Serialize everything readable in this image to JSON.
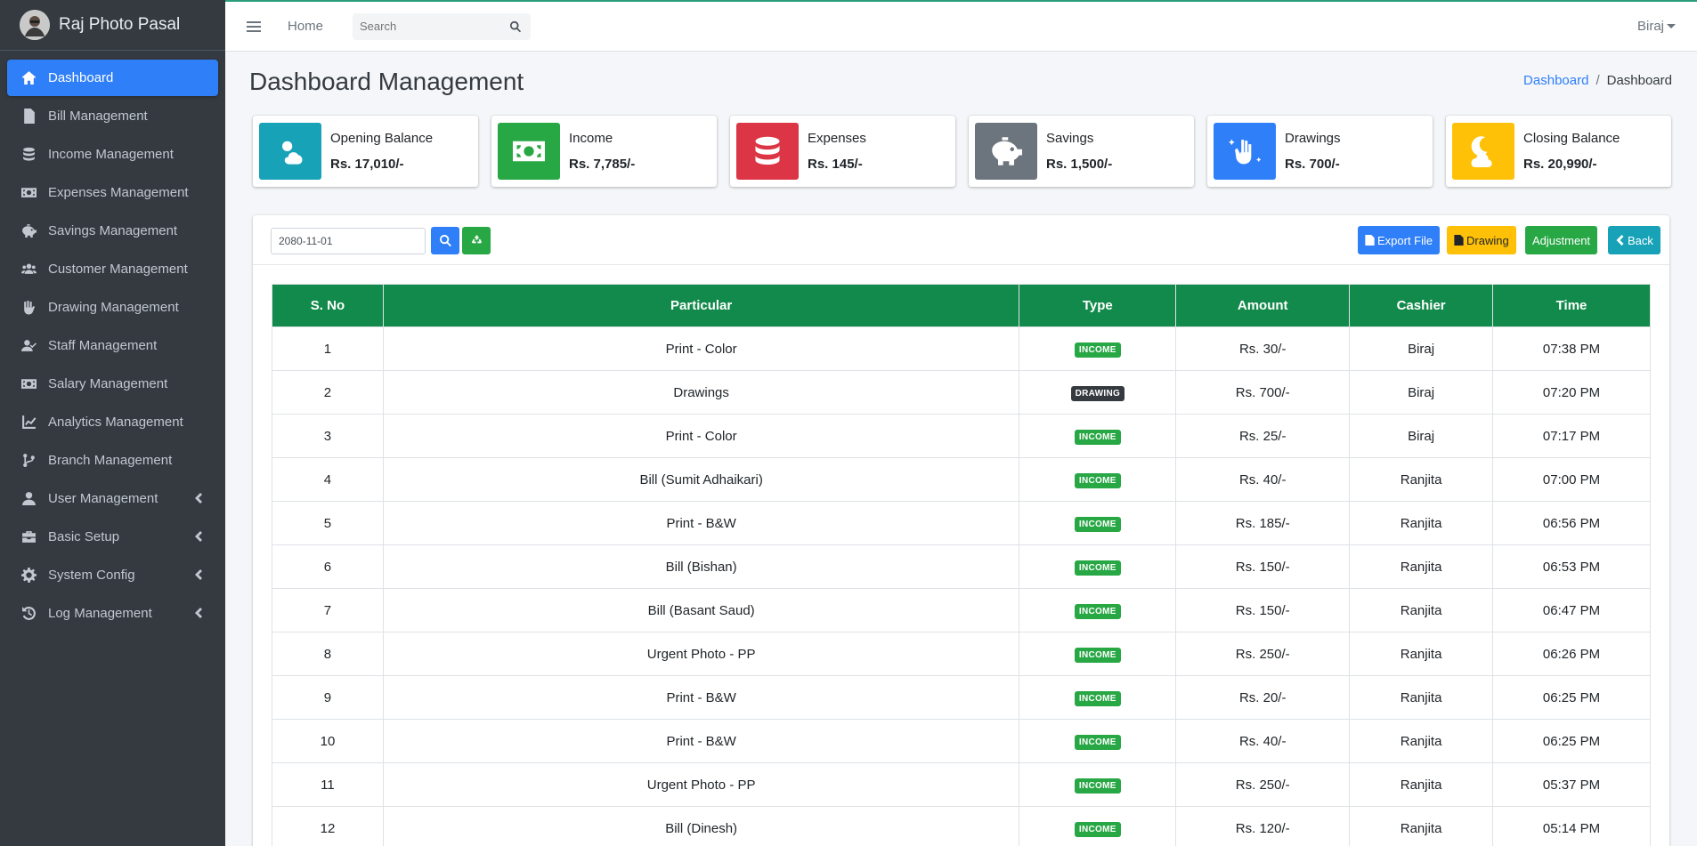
{
  "brand": {
    "name": "Raj Photo Pasal"
  },
  "sidebar": {
    "items": [
      {
        "label": "Dashboard",
        "icon": "home-icon",
        "active": true,
        "submenu": false
      },
      {
        "label": "Bill Management",
        "icon": "file-icon",
        "active": false,
        "submenu": false
      },
      {
        "label": "Income Management",
        "icon": "coins-icon",
        "active": false,
        "submenu": false
      },
      {
        "label": "Expenses Management",
        "icon": "money-bill-icon",
        "active": false,
        "submenu": false
      },
      {
        "label": "Savings Management",
        "icon": "piggy-bank-icon",
        "active": false,
        "submenu": false
      },
      {
        "label": "Customer Management",
        "icon": "users-icon",
        "active": false,
        "submenu": false
      },
      {
        "label": "Drawing Management",
        "icon": "hand-holding-icon",
        "active": false,
        "submenu": false
      },
      {
        "label": "Staff Management",
        "icon": "user-check-icon",
        "active": false,
        "submenu": false
      },
      {
        "label": "Salary Management",
        "icon": "money-bill-icon",
        "active": false,
        "submenu": false
      },
      {
        "label": "Analytics Management",
        "icon": "chart-line-icon",
        "active": false,
        "submenu": false
      },
      {
        "label": "Branch Management",
        "icon": "code-branch-icon",
        "active": false,
        "submenu": false
      },
      {
        "label": "User Management",
        "icon": "user-icon",
        "active": false,
        "submenu": true
      },
      {
        "label": "Basic Setup",
        "icon": "toolbox-icon",
        "active": false,
        "submenu": true
      },
      {
        "label": "System Config",
        "icon": "gear-icon",
        "active": false,
        "submenu": true
      },
      {
        "label": "Log Management",
        "icon": "history-icon",
        "active": false,
        "submenu": true
      }
    ]
  },
  "topbar": {
    "home_label": "Home",
    "search_placeholder": "Search",
    "user_name": "Biraj"
  },
  "page": {
    "title": "Dashboard Management",
    "breadcrumb_link": "Dashboard",
    "breadcrumb_current": "Dashboard"
  },
  "cards": [
    {
      "label": "Opening Balance",
      "value": "Rs. 17,010/-",
      "color": "#17a2b8",
      "icon": "cloud-sun-icon"
    },
    {
      "label": "Income",
      "value": "Rs. 7,785/-",
      "color": "#28a745",
      "icon": "money-bill-icon"
    },
    {
      "label": "Expenses",
      "value": "Rs. 145/-",
      "color": "#dc3545",
      "icon": "coins-icon"
    },
    {
      "label": "Savings",
      "value": "Rs. 1,500/-",
      "color": "#6c757d",
      "icon": "piggy-bank-icon"
    },
    {
      "label": "Drawings",
      "value": "Rs. 700/-",
      "color": "#2f7ff8",
      "icon": "hand-sparkles-icon"
    },
    {
      "label": "Closing Balance",
      "value": "Rs. 20,990/-",
      "color": "#ffc107",
      "icon": "cloud-moon-icon"
    }
  ],
  "filter": {
    "date_value": "2080-11-01"
  },
  "actions": {
    "export_label": "Export File",
    "drawing_label": "Drawing",
    "adjustment_label": "Adjustment",
    "back_label": "Back"
  },
  "table": {
    "headers": [
      "S. No",
      "Particular",
      "Type",
      "Amount",
      "Cashier",
      "Time"
    ],
    "rows": [
      {
        "sno": "1",
        "particular": "Print - Color",
        "type": "INCOME",
        "amount": "Rs. 30/-",
        "cashier": "Biraj",
        "time": "07:38 PM"
      },
      {
        "sno": "2",
        "particular": "Drawings",
        "type": "DRAWING",
        "amount": "Rs. 700/-",
        "cashier": "Biraj",
        "time": "07:20 PM"
      },
      {
        "sno": "3",
        "particular": "Print - Color",
        "type": "INCOME",
        "amount": "Rs. 25/-",
        "cashier": "Biraj",
        "time": "07:17 PM"
      },
      {
        "sno": "4",
        "particular": "Bill (Sumit Adhaikari)",
        "type": "INCOME",
        "amount": "Rs. 40/-",
        "cashier": "Ranjita",
        "time": "07:00 PM"
      },
      {
        "sno": "5",
        "particular": "Print - B&W",
        "type": "INCOME",
        "amount": "Rs. 185/-",
        "cashier": "Ranjita",
        "time": "06:56 PM"
      },
      {
        "sno": "6",
        "particular": "Bill (Bishan)",
        "type": "INCOME",
        "amount": "Rs. 150/-",
        "cashier": "Ranjita",
        "time": "06:53 PM"
      },
      {
        "sno": "7",
        "particular": "Bill (Basant Saud)",
        "type": "INCOME",
        "amount": "Rs. 150/-",
        "cashier": "Ranjita",
        "time": "06:47 PM"
      },
      {
        "sno": "8",
        "particular": "Urgent Photo - PP",
        "type": "INCOME",
        "amount": "Rs. 250/-",
        "cashier": "Ranjita",
        "time": "06:26 PM"
      },
      {
        "sno": "9",
        "particular": "Print - B&W",
        "type": "INCOME",
        "amount": "Rs. 20/-",
        "cashier": "Ranjita",
        "time": "06:25 PM"
      },
      {
        "sno": "10",
        "particular": "Print - B&W",
        "type": "INCOME",
        "amount": "Rs. 40/-",
        "cashier": "Ranjita",
        "time": "06:25 PM"
      },
      {
        "sno": "11",
        "particular": "Urgent Photo - PP",
        "type": "INCOME",
        "amount": "Rs. 250/-",
        "cashier": "Ranjita",
        "time": "05:37 PM"
      },
      {
        "sno": "12",
        "particular": "Bill (Dinesh)",
        "type": "INCOME",
        "amount": "Rs. 120/-",
        "cashier": "Ranjita",
        "time": "05:14 PM"
      }
    ]
  }
}
